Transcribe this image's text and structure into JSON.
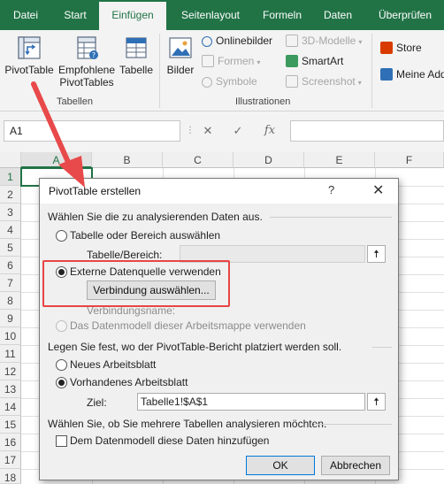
{
  "tabs": [
    "Datei",
    "Start",
    "Einfügen",
    "Seitenlayout",
    "Formeln",
    "Daten",
    "Überprüfen"
  ],
  "ribbon": {
    "tables": {
      "pivot_label": "PivotTable",
      "recommended_line1": "Empfohlene",
      "recommended_line2": "PivotTables",
      "table_label": "Tabelle",
      "group_label": "Tabellen"
    },
    "illustrations": {
      "images_label": "Bilder",
      "online_images": "Onlinebilder",
      "shapes": "Formen",
      "symbols": "Symbole",
      "models_3d": "3D-Modelle",
      "smartart": "SmartArt",
      "screenshot": "Screenshot",
      "group_label": "Illustrationen"
    },
    "addins": {
      "store": "Store",
      "my_addins": "Meine Add"
    }
  },
  "formula_bar": {
    "name_box": "A1",
    "cancel": "✕",
    "confirm": "✓",
    "fx": "fx"
  },
  "grid": {
    "columns": [
      "A",
      "B",
      "C",
      "D",
      "E",
      "F"
    ],
    "rows": [
      "1",
      "2",
      "3",
      "4",
      "5",
      "6",
      "7",
      "8",
      "9",
      "10",
      "11",
      "12",
      "13",
      "14",
      "15",
      "16",
      "17",
      "18"
    ]
  },
  "dialog": {
    "title": "PivotTable erstellen",
    "help": "?",
    "close": "✕",
    "section1": "Wählen Sie die zu analysierenden Daten aus.",
    "radio_table_range": "Tabelle oder Bereich auswählen",
    "table_range_label": "Tabelle/Bereich:",
    "radio_external": "Externe Datenquelle verwenden",
    "choose_connection": "Verbindung auswählen...",
    "connection_name_label": "Verbindungsname:",
    "radio_datamodel": "Das Datenmodell dieser Arbeitsmappe verwenden",
    "section2": "Legen Sie fest, wo der PivotTable-Bericht platziert werden soll.",
    "radio_new_sheet": "Neues Arbeitsblatt",
    "radio_existing_sheet": "Vorhandenes Arbeitsblatt",
    "target_label": "Ziel:",
    "target_value": "Tabelle1!$A$1",
    "section3": "Wählen Sie, ob Sie mehrere Tabellen analysieren möchten.",
    "add_datamodel": "Dem Datenmodell diese Daten hinzufügen",
    "ok": "OK",
    "cancel": "Abbrechen"
  },
  "colors": {
    "excel_green": "#217346",
    "highlight_red": "#e84545",
    "arrow_red": "#e8494a"
  }
}
